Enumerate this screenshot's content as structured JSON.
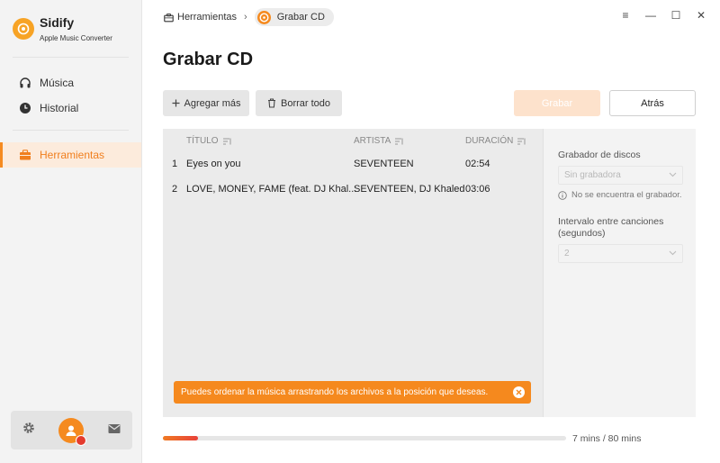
{
  "app": {
    "name": "Sidify",
    "subtitle": "Apple Music Converter",
    "accent_color": "#f58a1f"
  },
  "sidebar": {
    "items": [
      {
        "label": "Música",
        "icon": "headphones-icon"
      },
      {
        "label": "Historial",
        "icon": "clock-icon"
      },
      {
        "label": "Herramientas",
        "icon": "toolbox-icon",
        "active": true
      }
    ],
    "bottom": {
      "settings_icon": "gear-icon",
      "avatar_icon": "user-avatar-icon",
      "mail_icon": "mail-icon"
    }
  },
  "breadcrumb": {
    "parent": "Herramientas",
    "separator": "›",
    "current": "Grabar CD"
  },
  "window_controls": {
    "menu": "≡",
    "minimize": "—",
    "maximize": "☐",
    "close": "✕"
  },
  "page": {
    "title": "Grabar CD"
  },
  "toolbar": {
    "add_label": "Agregar más",
    "clear_label": "Borrar todo",
    "burn_label": "Grabar",
    "back_label": "Atrás"
  },
  "table": {
    "columns": [
      "TÍTULO",
      "ARTISTA",
      "DURACIÓN"
    ],
    "rows": [
      {
        "num": "1",
        "title": "Eyes on you",
        "artist": "SEVENTEEN",
        "duration": "02:54"
      },
      {
        "num": "2",
        "title": "LOVE, MONEY, FAME (feat. DJ Khal...",
        "artist": "SEVENTEEN, DJ Khaled",
        "duration": "03:06"
      }
    ]
  },
  "toast": {
    "message": "Puedes ordenar la música arrastrando los archivos a la posición que deseas."
  },
  "settings_panel": {
    "recorder_label": "Grabador de discos",
    "recorder_value": "Sin grabadora",
    "recorder_hint": "No se encuentra el grabador.",
    "interval_label_line1": "Intervalo entre canciones",
    "interval_label_line2": "(segundos)",
    "interval_value": "2"
  },
  "progress": {
    "fraction": 0.0875,
    "label": "7 mins / 80 mins"
  }
}
